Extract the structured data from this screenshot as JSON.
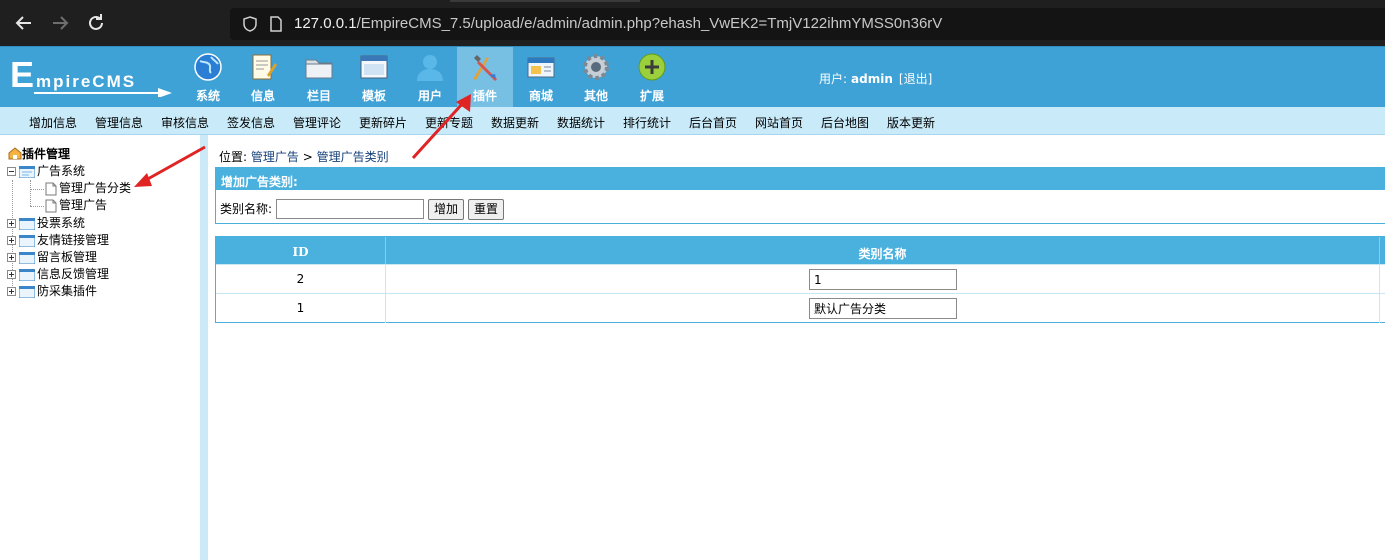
{
  "browser": {
    "url_host": "127.0.0.1",
    "url_path": "/EmpireCMS_7.5/upload/e/admin/admin.php?ehash_VwEK2=TmjV122ihmYMSS0n36rV"
  },
  "header": {
    "logo_text": "EmpireCMS",
    "menu": [
      {
        "label": "系统",
        "icon": "globe-icon"
      },
      {
        "label": "信息",
        "icon": "document-edit-icon"
      },
      {
        "label": "栏目",
        "icon": "folder-icon"
      },
      {
        "label": "模板",
        "icon": "window-template-icon"
      },
      {
        "label": "用户",
        "icon": "user-icon"
      },
      {
        "label": "插件",
        "icon": "tools-icon"
      },
      {
        "label": "商城",
        "icon": "store-card-icon"
      },
      {
        "label": "其他",
        "icon": "gear-icon"
      },
      {
        "label": "扩展",
        "icon": "plus-circle-icon"
      }
    ],
    "active_menu": "插件",
    "user_label": "用户:",
    "username": "admin",
    "logout": "[退出]"
  },
  "quickbar": {
    "links": [
      "增加信息",
      "管理信息",
      "审核信息",
      "签发信息",
      "管理评论",
      "更新碎片",
      "更新专题",
      "数据更新",
      "数据统计",
      "排行统计",
      "后台首页",
      "网站首页",
      "后台地图",
      "版本更新"
    ]
  },
  "sidebar": {
    "title": "插件管理",
    "tree": {
      "ad_system": "广告系统",
      "ad_children": [
        "管理广告分类",
        "管理广告"
      ],
      "others": [
        "投票系统",
        "友情链接管理",
        "留言板管理",
        "信息反馈管理",
        "防采集插件"
      ]
    }
  },
  "main": {
    "breadcrumb": {
      "prefix": "位置:",
      "link1": "管理广告",
      "sep": ">",
      "link2": "管理广告类别"
    },
    "add_panel": {
      "title": "增加广告类别:",
      "field_label": "类别名称:",
      "input_value": "",
      "add_button": "增加",
      "reset_button": "重置"
    },
    "table": {
      "headers": [
        "ID",
        "类别名称"
      ],
      "rows": [
        {
          "id": "2",
          "name": "1"
        },
        {
          "id": "1",
          "name": "默认广告分类"
        }
      ]
    }
  },
  "colors": {
    "header_bg": "#3fa2d6",
    "quickbar_bg": "#c8eaf9",
    "panel_head": "#4ab0de",
    "annotation_arrow": "#e02424"
  }
}
